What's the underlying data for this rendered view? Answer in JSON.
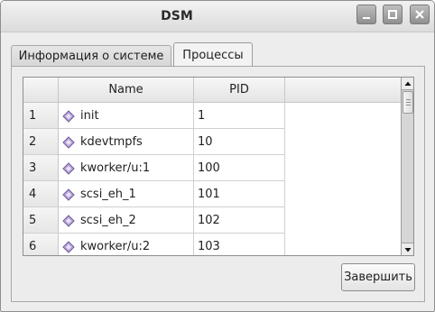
{
  "window": {
    "title": "DSM",
    "controls": {
      "minimize": "minimize-icon",
      "maximize": "maximize-icon",
      "close": "close-icon"
    }
  },
  "tabs": [
    {
      "label": "Информация о системе",
      "active": false
    },
    {
      "label": "Процессы",
      "active": true
    }
  ],
  "table": {
    "columns": [
      "Name",
      "PID"
    ],
    "rows": [
      {
        "num": "1",
        "name": "init",
        "pid": "1"
      },
      {
        "num": "2",
        "name": "kdevtmpfs",
        "pid": "10"
      },
      {
        "num": "3",
        "name": "kworker/u:1",
        "pid": "100"
      },
      {
        "num": "4",
        "name": "scsi_eh_1",
        "pid": "101"
      },
      {
        "num": "5",
        "name": "scsi_eh_2",
        "pid": "102"
      },
      {
        "num": "6",
        "name": "kworker/u:2",
        "pid": "103"
      }
    ],
    "row_icon": "process-diamond-icon"
  },
  "actions": {
    "finish_label": "Завершить"
  },
  "colors": {
    "window_bg": "#ededed",
    "icon_fill": "#a58ec9"
  }
}
